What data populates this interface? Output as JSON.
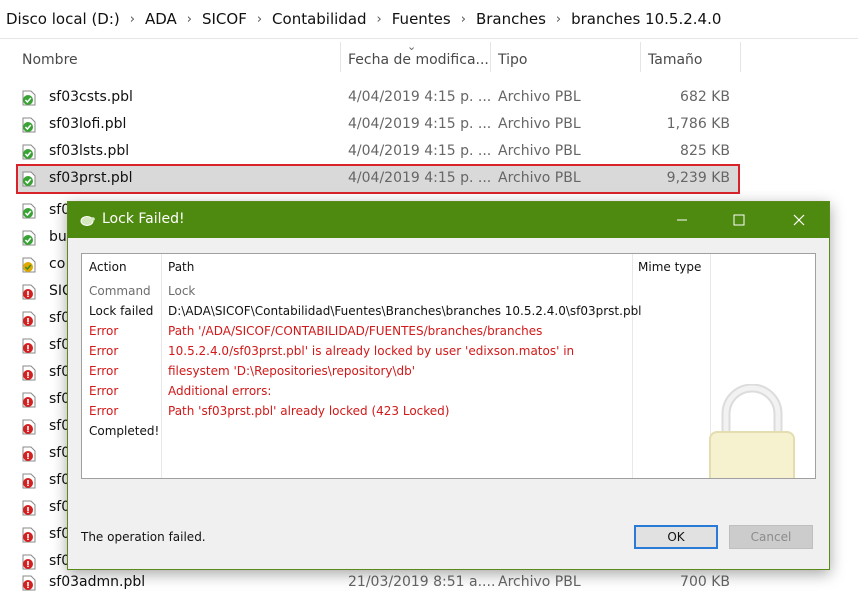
{
  "breadcrumb": [
    "Disco local (D:)",
    "ADA",
    "SICOF",
    "Contabilidad",
    "Fuentes",
    "Branches",
    "branches 10.5.2.4.0"
  ],
  "columns": {
    "name": "Nombre",
    "date": "Fecha de modifica...",
    "type": "Tipo",
    "size": "Tamaño"
  },
  "files_top": [
    {
      "name": "sf03csts.pbl",
      "date": "4/04/2019 4:15 p. ...",
      "type": "Archivo PBL",
      "size": "682 KB",
      "status": "ok"
    },
    {
      "name": "sf03lofi.pbl",
      "date": "4/04/2019 4:15 p. ...",
      "type": "Archivo PBL",
      "size": "1,786 KB",
      "status": "ok"
    },
    {
      "name": "sf03lsts.pbl",
      "date": "4/04/2019 4:15 p. ...",
      "type": "Archivo PBL",
      "size": "825 KB",
      "status": "ok"
    },
    {
      "name": "sf03prst.pbl",
      "date": "4/04/2019 4:15 p. ...",
      "type": "Archivo PBL",
      "size": "9,239 KB",
      "status": "ok",
      "selected": true
    }
  ],
  "files_left": [
    {
      "name": "sf0",
      "status": "ok"
    },
    {
      "name": "bu",
      "status": "ok"
    },
    {
      "name": "co",
      "status": "modified"
    },
    {
      "name": "SIC",
      "status": "conflict"
    },
    {
      "name": "sf0",
      "status": "conflict"
    },
    {
      "name": "sf0",
      "status": "conflict"
    },
    {
      "name": "sf0",
      "status": "conflict"
    },
    {
      "name": "sf0",
      "status": "conflict"
    },
    {
      "name": "sf0",
      "status": "conflict"
    },
    {
      "name": "sf0",
      "status": "conflict"
    },
    {
      "name": "sf0",
      "status": "conflict"
    },
    {
      "name": "sf0",
      "status": "conflict"
    },
    {
      "name": "sf0",
      "status": "conflict"
    },
    {
      "name": "sf0",
      "status": "conflict"
    }
  ],
  "file_bottom": {
    "name": "sf03admn.pbl",
    "date": "21/03/2019 8:51 a....",
    "type": "Archivo PBL",
    "size": "700 KB",
    "status": "conflict"
  },
  "dialog": {
    "title": "Lock Failed!",
    "columns": {
      "action": "Action",
      "path": "Path",
      "mime": "Mime type"
    },
    "rows": [
      {
        "action": "Command",
        "path": "Lock",
        "kind": "grey"
      },
      {
        "action": "Lock failed",
        "path": "D:\\ADA\\SICOF\\Contabilidad\\Fuentes\\Branches\\branches 10.5.2.4.0\\sf03prst.pbl",
        "kind": "black"
      },
      {
        "action": "Error",
        "path": "Path '/ADA/SICOF/CONTABILIDAD/FUENTES/branches/branches",
        "kind": "red"
      },
      {
        "action": "Error",
        "path": " 10.5.2.4.0/sf03prst.pbl' is already locked by user 'edixson.matos' in",
        "kind": "red"
      },
      {
        "action": "Error",
        "path": " filesystem 'D:\\Repositories\\repository\\db'",
        "kind": "red"
      },
      {
        "action": "Error",
        "path": "Additional errors:",
        "kind": "red"
      },
      {
        "action": "Error",
        "path": "Path 'sf03prst.pbl' already locked (423 Locked)",
        "kind": "red"
      },
      {
        "action": "Completed!",
        "path": "",
        "kind": "black"
      }
    ],
    "status": "The operation failed.",
    "ok_label": "OK",
    "cancel_label": "Cancel"
  },
  "colors": {
    "titlebar": "#4f8a10",
    "error": "#d11919",
    "selection_outline": "#d9232b"
  }
}
